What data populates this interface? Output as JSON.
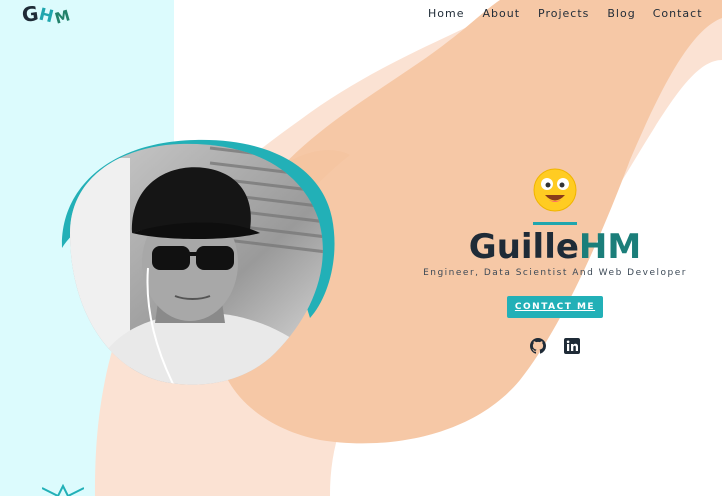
{
  "brand": {
    "logo_letters": [
      "G",
      "H",
      "M"
    ]
  },
  "nav": {
    "items": [
      {
        "label": "Home"
      },
      {
        "label": "About"
      },
      {
        "label": "Projects"
      },
      {
        "label": "Blog"
      },
      {
        "label": "Contact"
      }
    ]
  },
  "hero": {
    "name_first": "Guille",
    "name_last": "HM",
    "subtitle": "Engineer, Data Scientist And Web Developer",
    "cta_label": "CONTACT ME",
    "socials": [
      {
        "icon": "github-icon"
      },
      {
        "icon": "linkedin-icon"
      }
    ]
  },
  "colors": {
    "accent": "#22b0b7",
    "dark": "#1f2b37",
    "teal_text": "#1b7e7a",
    "peach": "#f6c8a6",
    "light_peach": "#fbe2d3",
    "panel": "#dcfbfd"
  }
}
